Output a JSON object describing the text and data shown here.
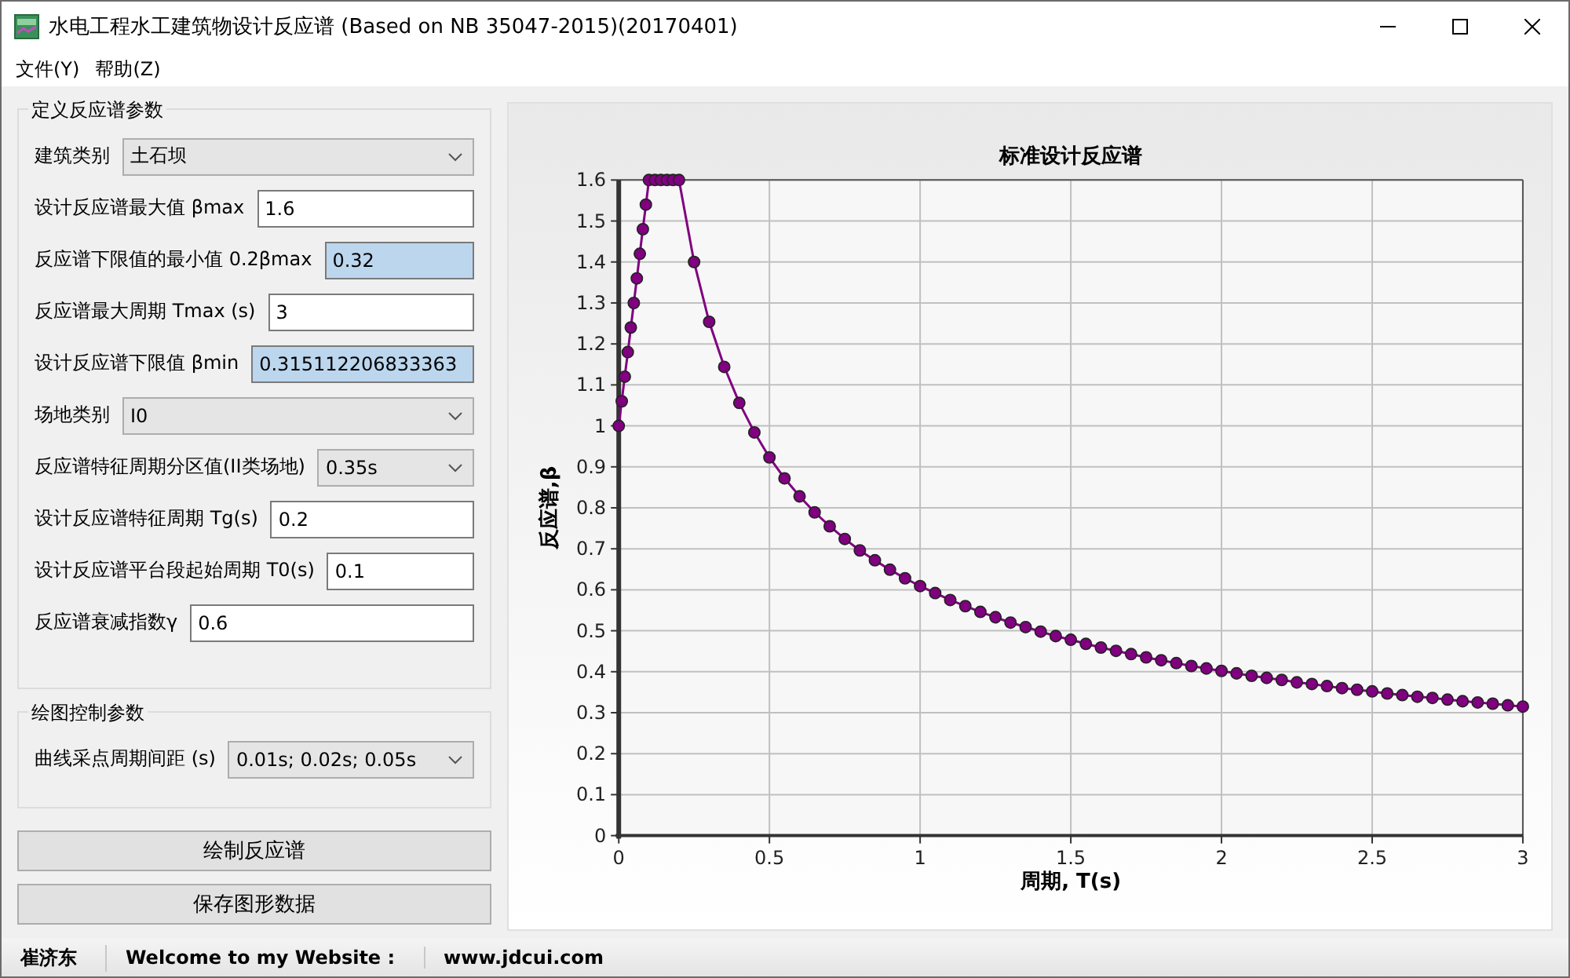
{
  "window": {
    "title": "水电工程水工建筑物设计反应谱 (Based on NB 35047-2015)(20170401)"
  },
  "menu": [
    "文件(Y)",
    "帮助(Z)"
  ],
  "parameters": {
    "title": "定义反应谱参数",
    "fields": [
      {
        "label": "建筑类别",
        "value": "土石坝",
        "kind": "select"
      },
      {
        "label": "设计反应谱最大值 βmax",
        "value": "1.6",
        "kind": "input"
      },
      {
        "label": "反应谱下限值的最小值 0.2βmax",
        "value": "0.32",
        "kind": "computed"
      },
      {
        "label": "反应谱最大周期 Tmax (s)",
        "value": "3",
        "kind": "input"
      },
      {
        "label": "设计反应谱下限值 βmin",
        "value": "0.315112206833363",
        "kind": "computed"
      },
      {
        "label": "场地类别",
        "value": "I0",
        "kind": "select"
      },
      {
        "label": "反应谱特征周期分区值(II类场地)",
        "value": "0.35s",
        "kind": "select"
      },
      {
        "label": "设计反应谱特征周期 Tg(s)",
        "value": "0.2",
        "kind": "input"
      },
      {
        "label": "设计反应谱平台段起始周期 T0(s)",
        "value": "0.1",
        "kind": "input"
      },
      {
        "label": "反应谱衰减指数γ",
        "value": "0.6",
        "kind": "input"
      }
    ]
  },
  "plot_controls": {
    "title": "绘图控制参数",
    "fields": [
      {
        "label": "曲线采点周期间距 (s)",
        "value": "0.01s; 0.02s; 0.05s",
        "kind": "select"
      }
    ]
  },
  "buttons": [
    "绘制反应谱",
    "保存图形数据"
  ],
  "chart": {
    "chart_data": {
      "type": "line",
      "title": "标准设计反应谱",
      "xlabel": "周期, T(s)",
      "ylabel": "反应谱,β",
      "x": [
        0,
        0.01,
        0.02,
        0.03,
        0.04,
        0.05,
        0.06,
        0.07,
        0.08,
        0.09,
        0.1,
        0.12,
        0.14,
        0.16,
        0.18,
        0.2,
        0.25,
        0.3,
        0.35,
        0.4,
        0.45,
        0.5,
        0.55,
        0.6,
        0.65,
        0.7,
        0.75,
        0.8,
        0.85,
        0.9,
        0.95,
        1,
        1.05,
        1.1,
        1.15,
        1.2,
        1.25,
        1.3,
        1.35,
        1.4,
        1.45,
        1.5,
        1.55,
        1.6,
        1.65,
        1.7,
        1.75,
        1.8,
        1.85,
        1.9,
        1.95,
        2,
        2.05,
        2.1,
        2.15,
        2.2,
        2.25,
        2.3,
        2.35,
        2.4,
        2.45,
        2.5,
        2.55,
        2.6,
        2.65,
        2.7,
        2.75,
        2.8,
        2.85,
        2.9,
        2.95,
        3
      ],
      "series": [
        {
          "color": "#800080",
          "marker": "circle",
          "values": [
            1,
            1.06,
            1.12,
            1.18,
            1.24,
            1.3,
            1.36,
            1.42,
            1.48,
            1.54,
            1.6,
            1.6,
            1.6,
            1.6,
            1.6,
            1.6,
            1.4,
            1.254,
            1.144,
            1.056,
            0.984,
            0.923,
            0.872,
            0.828,
            0.789,
            0.755,
            0.724,
            0.696,
            0.672,
            0.649,
            0.628,
            0.609,
            0.592,
            0.575,
            0.56,
            0.546,
            0.533,
            0.52,
            0.509,
            0.498,
            0.487,
            0.478,
            0.468,
            0.459,
            0.451,
            0.443,
            0.435,
            0.428,
            0.421,
            0.414,
            0.408,
            0.402,
            0.396,
            0.39,
            0.385,
            0.38,
            0.374,
            0.37,
            0.365,
            0.36,
            0.356,
            0.352,
            0.347,
            0.343,
            0.339,
            0.336,
            0.332,
            0.328,
            0.325,
            0.322,
            0.318,
            0.315
          ]
        }
      ],
      "grid": true,
      "xlim": [
        0,
        3
      ],
      "ylim": [
        0,
        1.6
      ],
      "xticks": [
        0,
        0.5,
        1,
        1.5,
        2,
        2.5,
        3
      ],
      "yticks": [
        0,
        0.1,
        0.2,
        0.3,
        0.4,
        0.5,
        0.6,
        0.7,
        0.8,
        0.9,
        1,
        1.1,
        1.2,
        1.3,
        1.4,
        1.5,
        1.6
      ]
    }
  },
  "status_bar": [
    "崔济东",
    "Welcome to my Website :",
    "www.jdcui.com"
  ]
}
